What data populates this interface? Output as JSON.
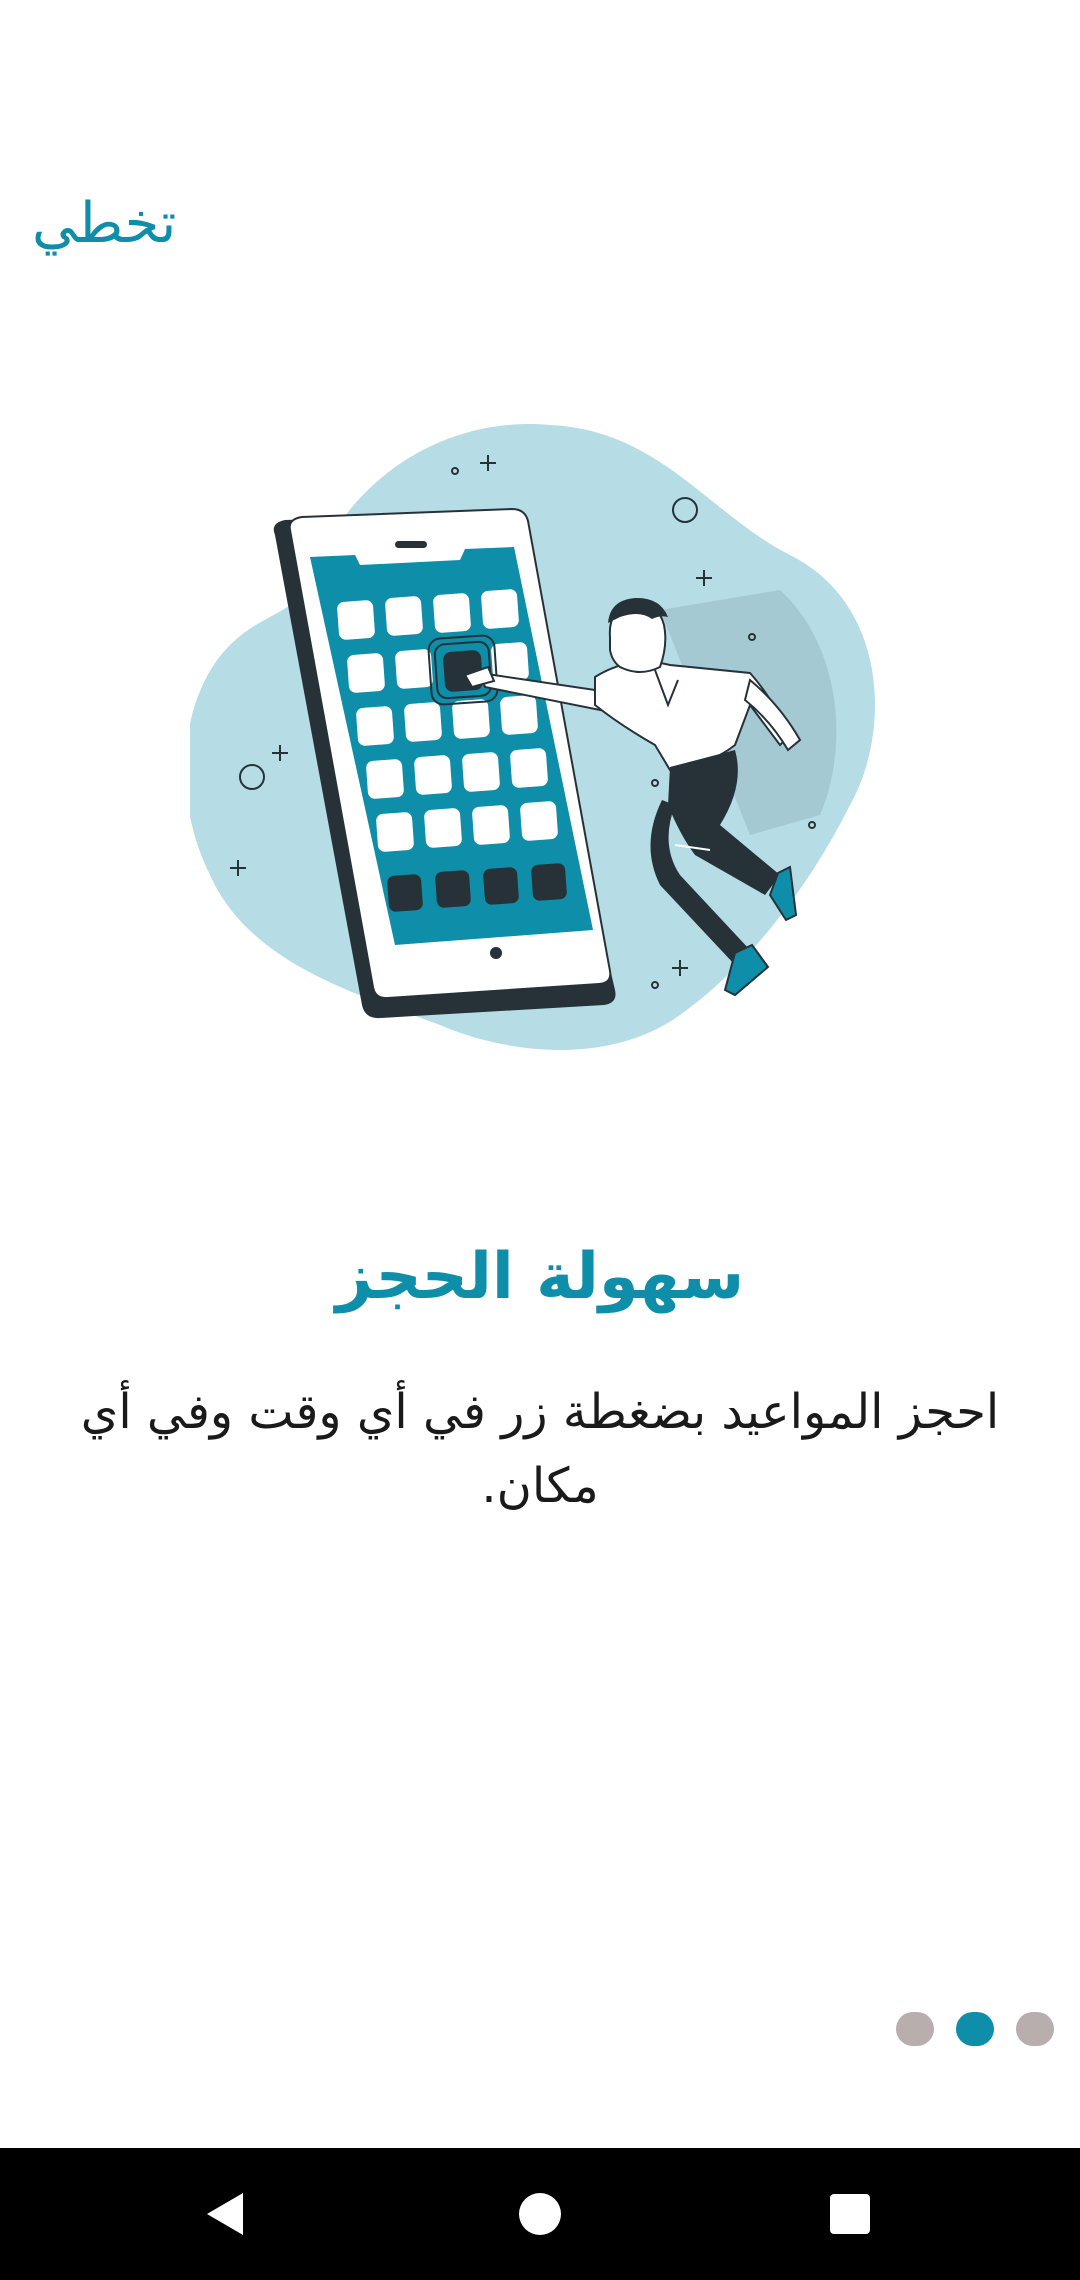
{
  "header": {
    "skip_label": "تخطي"
  },
  "onboarding": {
    "title": "سهولة الحجز",
    "description": "احجز المواعيد بضغطة زر في أي وقت وفي أي مكان.",
    "illustration_icon": "phone-booking-illustration",
    "page_indicator": {
      "total": 3,
      "active_index": 1
    }
  },
  "colors": {
    "accent": "#0e8ea9",
    "dot_inactive": "#b9aeae",
    "blob": "#b6dde6",
    "dark": "#263238"
  },
  "system_nav": {
    "back_icon": "back-triangle-icon",
    "home_icon": "home-circle-icon",
    "recents_icon": "recents-square-icon"
  }
}
